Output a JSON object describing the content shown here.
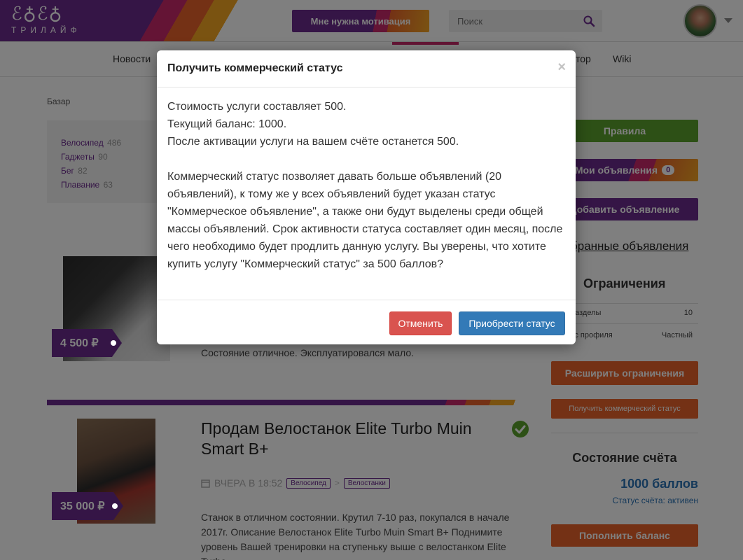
{
  "header": {
    "logo_text": "ТРИЛАЙФ",
    "motivation_button": "Мне нужна мотивация",
    "search_placeholder": "Поиск"
  },
  "nav": {
    "items": [
      {
        "label": "Новости"
      },
      {
        "label": "тор"
      },
      {
        "label": "Wiki"
      }
    ]
  },
  "breadcrumb": "Базар",
  "categories": [
    {
      "label": "Велосипед",
      "count": "486"
    },
    {
      "label": "Гаджеты",
      "count": "90"
    },
    {
      "label": "Бег",
      "count": "82"
    },
    {
      "label": "Плавание",
      "count": "63"
    }
  ],
  "listings": [
    {
      "price": "4 500 ₽",
      "description": "Состояние отличное. Эксплуатировался мало."
    },
    {
      "price": "35 000 ₽",
      "title": "Продам Велостанок Elite Turbo Muin Smart B+",
      "date": "ВЧЕРА В 18:52",
      "tags": [
        "Велосипед",
        "Велостанки"
      ],
      "tag_separator": ">",
      "description": "Станок в отличном состоянии. Крутил 7-10 раз, покупался в начале 2017г. Описание Велостанок Elite Turbo Muin Smart B+ Поднимите уровень Вашей тренировки на ступеньку выше с велостанком Elite Turbo"
    }
  ],
  "sidebar": {
    "rules_button": "Правила",
    "my_ads_button": "Мои объявления",
    "my_ads_count": "0",
    "add_ad_button": "Добавить объявление",
    "favorites_link": "бранные объявления",
    "limits_title": "Ограничения",
    "limits_rows": [
      {
        "label": "разделы",
        "value": "10"
      },
      {
        "label": "ус профиля",
        "value": "Частный"
      }
    ],
    "expand_button": "Расширить ограничения",
    "commercial_button": "Получить коммерческий статус",
    "account_title": "Состояние счёта",
    "balance": "1000 баллов",
    "account_status": "Статус счёта: активен",
    "topup_button": "Пополнить баланс"
  },
  "modal": {
    "title": "Получить коммерческий статус",
    "close_symbol": "×",
    "line_cost": "Стоимость услуги составляет 500.",
    "line_balance": "Текущий баланс: 1000.",
    "line_after": "После активации услуги на вашем счёте останется 500.",
    "paragraph": "Коммерческий статус позволяет давать больше объявлений (20 объявлений), к тому же у всех объявлений будет указан статус \"Коммерческое объявление\", а также они будут выделены среди общей массы объявлений. Срок активности статуса составляет один месяц, после чего необходимо будет продлить данную услугу. Вы уверены, что хотите купить услугу \"Коммерческий статус\" за 500 баллов?",
    "cancel_button": "Отменить",
    "confirm_button": "Приобрести статус"
  },
  "colors": {
    "brand_purple": "#6a2a8c",
    "brand_orange": "#e8632b",
    "rules_green": "#5aa02c",
    "balance_blue": "#2a72b5",
    "cancel_red": "#d9534f",
    "confirm_blue": "#337ab7"
  },
  "icons": {
    "search": "search-icon",
    "calendar": "calendar-icon",
    "verified": "check-circle-icon",
    "close": "close-icon"
  }
}
